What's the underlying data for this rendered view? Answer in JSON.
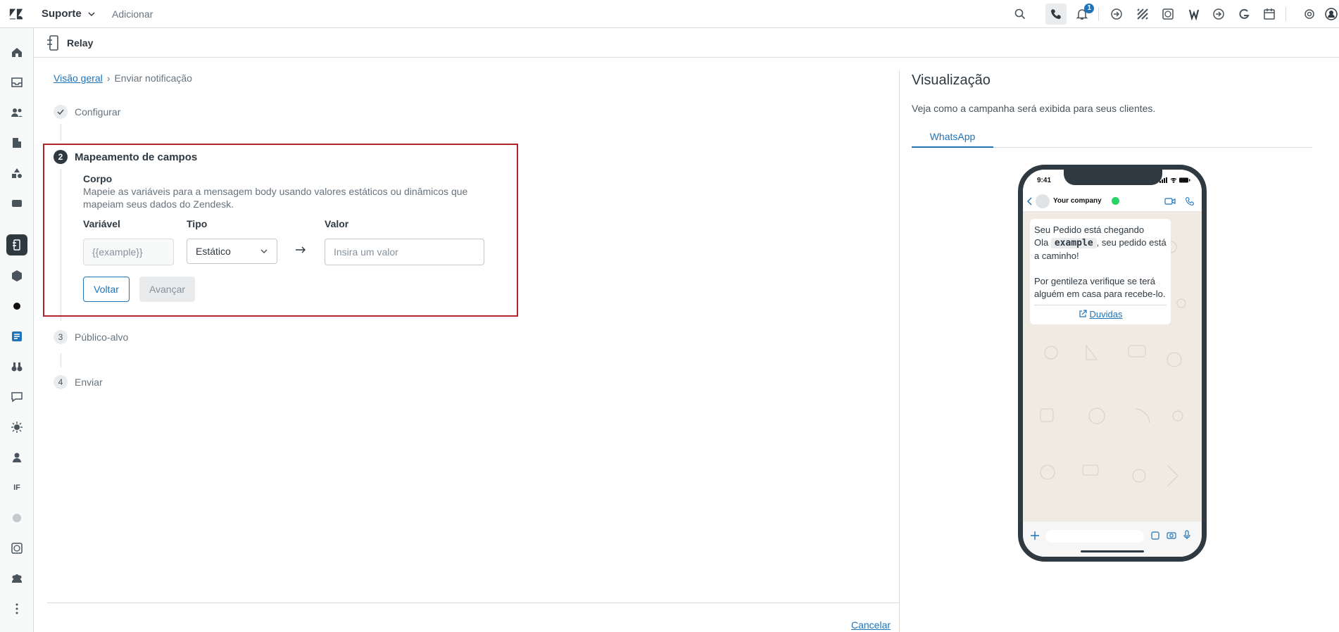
{
  "topbar": {
    "product": "Suporte",
    "add": "Adicionar",
    "notification_count": "1"
  },
  "app": {
    "title": "Relay"
  },
  "breadcrumb": {
    "overview": "Visão geral",
    "current": "Enviar notificação"
  },
  "steps": [
    {
      "num": "1",
      "label": "Configurar",
      "state": "done"
    },
    {
      "num": "2",
      "label": "Mapeamento de campos",
      "state": "active"
    },
    {
      "num": "3",
      "label": "Público-alvo",
      "state": "pending"
    },
    {
      "num": "4",
      "label": "Enviar",
      "state": "pending"
    }
  ],
  "mapping": {
    "section_title": "Corpo",
    "section_desc": "Mapeie as variáveis para a mensagem body usando valores estáticos ou dinâmicos que mapeiam seus dados do Zendesk.",
    "col_variable": "Variável",
    "col_type": "Tipo",
    "col_value": "Valor",
    "variable_value": "{{example}}",
    "type_selected": "Estático",
    "value_placeholder": "Insira um valor",
    "back_label": "Voltar",
    "next_label": "Avançar"
  },
  "footer": {
    "cancel": "Cancelar"
  },
  "preview": {
    "title": "Visualização",
    "desc": "Veja como a campanha será exibida para seus clientes.",
    "tab": "WhatsApp",
    "phone_time": "9:41",
    "company": "Your company",
    "msg_line1": "Seu Pedido está chegando",
    "msg_ola": "Ola",
    "msg_tag": "example",
    "msg_rest": ", seu pedido está a caminho!",
    "msg_para2": "Por gentileza verifique se terá alguém em casa para recebe-lo.",
    "cta": "Duvidas"
  },
  "colors": {
    "accent": "#1f73b7",
    "highlight": "#b0232a",
    "dark": "#2f3941"
  }
}
